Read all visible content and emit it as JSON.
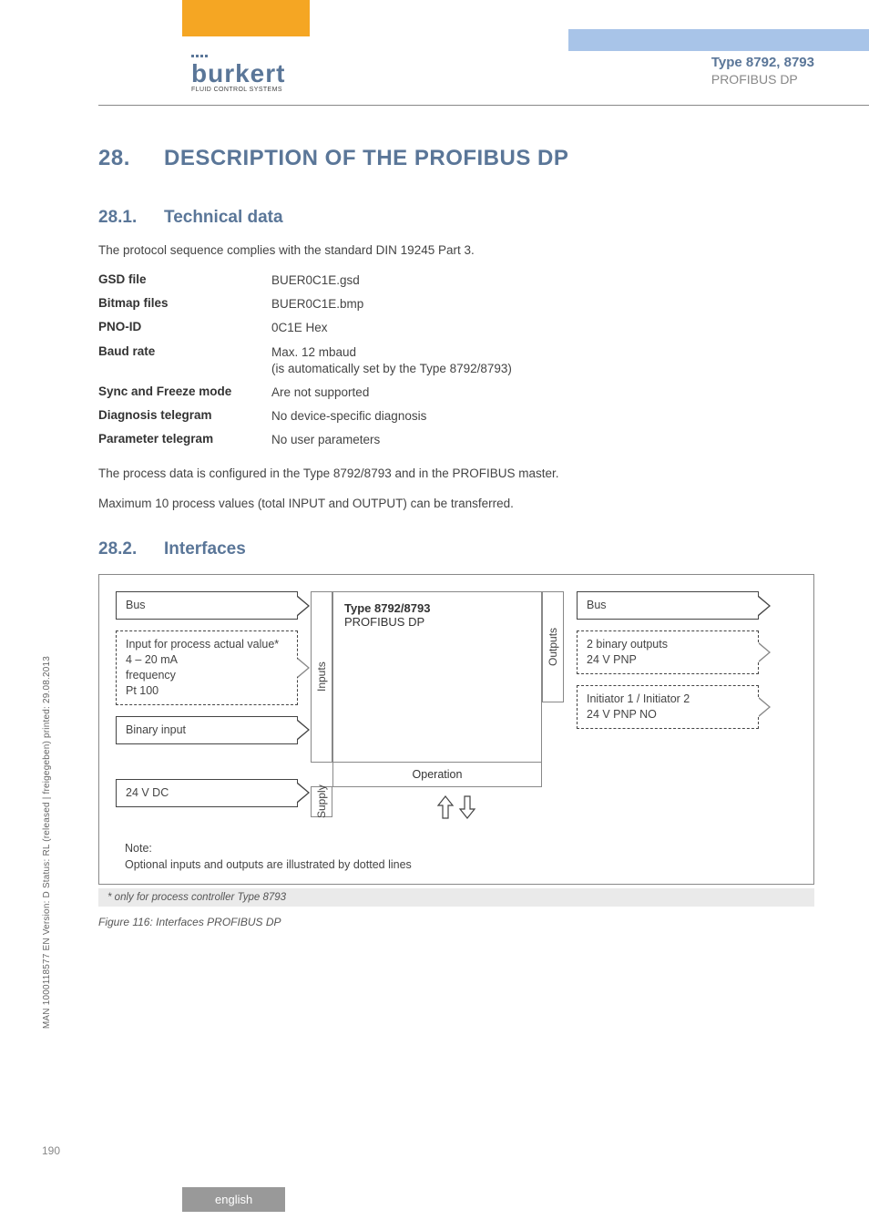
{
  "header": {
    "type_line": "Type 8792, 8793",
    "sub_line": "PROFIBUS DP",
    "logo_text": "burkert",
    "logo_sub": "FLUID CONTROL SYSTEMS"
  },
  "section": {
    "num": "28.",
    "title": "DESCRIPTION OF THE PROFIBUS DP"
  },
  "sub1": {
    "num": "28.1.",
    "title": "Technical data",
    "intro": "The protocol sequence complies with the standard DIN 19245 Part 3.",
    "specs": [
      {
        "label": "GSD file",
        "value": "BUER0C1E.gsd"
      },
      {
        "label": "Bitmap files",
        "value": "BUER0C1E.bmp"
      },
      {
        "label": "PNO-ID",
        "value": "0C1E Hex"
      },
      {
        "label": "Baud rate",
        "value": "Max. 12 mbaud\n(is automatically set by the Type 8792/8793)"
      },
      {
        "label": "Sync and Freeze mode",
        "value": "Are not supported"
      },
      {
        "label": "Diagnosis telegram",
        "value": "No device-specific diagnosis"
      },
      {
        "label": "Parameter telegram",
        "value": "No user parameters"
      }
    ],
    "post1": "The process data is configured in the Type 8792/8793 and in the PROFIBUS master.",
    "post2": "Maximum 10 process values (total INPUT and OUTPUT) can be transferred."
  },
  "sub2": {
    "num": "28.2.",
    "title": "Interfaces"
  },
  "diagram": {
    "left_bus": "Bus",
    "left_input_proc": "Input for process actual value*\n4 – 20 mA\nfrequency\nPt 100",
    "left_binary": "Binary input",
    "left_supply": "24 V DC",
    "inputs_label": "Inputs",
    "supply_label": "Supply",
    "mid_title": "Type 8792/8793",
    "mid_sub": "PROFIBUS DP",
    "outputs_label": "Outputs",
    "right_bus": "Bus",
    "right_binout": "2 binary outputs\n24 V PNP",
    "right_init": "Initiator 1 / Initiator 2\n24 V PNP NO",
    "operation": "Operation",
    "note_label": "Note:",
    "note_text": "Optional inputs and outputs are illustrated by dotted lines",
    "footnote": "*  only for process controller Type 8793"
  },
  "figure": {
    "caption": "Figure 116:    Interfaces PROFIBUS DP"
  },
  "side_text": "MAN  1000118577  EN  Version: D  Status: RL (released | freigegeben)  printed: 29.08.2013",
  "page_num": "190",
  "lang_tab": "english"
}
